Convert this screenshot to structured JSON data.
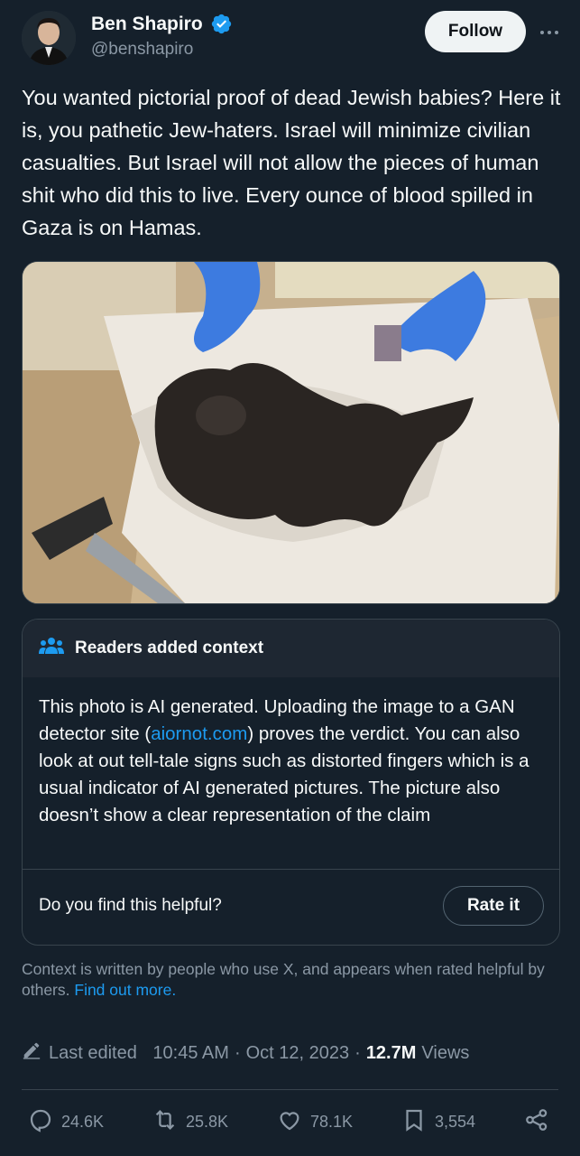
{
  "author": {
    "display_name": "Ben Shapiro",
    "handle": "@benshapiro",
    "verified": true
  },
  "header": {
    "follow_label": "Follow",
    "more_icon": "more-horizontal-icon"
  },
  "tweet": {
    "text": "You wanted pictorial proof of dead Jewish babies? Here it is, you pathetic Jew-haters. Israel will minimize civilian casualties. But Israel will not allow the pieces of human shit who did this to live. Every ounce of blood spilled in Gaza is on Hamas."
  },
  "community_note": {
    "header_title": "Readers added context",
    "body_before_link": "This photo is AI generated. Uploading the image to a GAN detector site (",
    "body_link": "aiornot.com",
    "body_after_link": ") proves the verdict. You can also look at out tell-tale signs such as distorted fingers which is a usual indicator of AI generated pictures. The picture also doesn’t show a clear representation of the claim",
    "helpful_question": "Do you find this helpful?",
    "rate_label": "Rate it",
    "footnote": "Context is written by people who use X, and appears when rated helpful by others.",
    "footnote_link": "Find out more."
  },
  "meta": {
    "edited_label": "Last edited",
    "time": "10:45 AM",
    "date": "Oct 12, 2023",
    "views_count": "12.7M",
    "views_label": "Views"
  },
  "actions": {
    "replies": "24.6K",
    "reposts": "25.8K",
    "likes": "78.1K",
    "bookmarks": "3,554"
  },
  "colors": {
    "background": "#15202b",
    "accent": "#1d9bf0",
    "muted_text": "#8b98a5",
    "border": "#38444d"
  }
}
